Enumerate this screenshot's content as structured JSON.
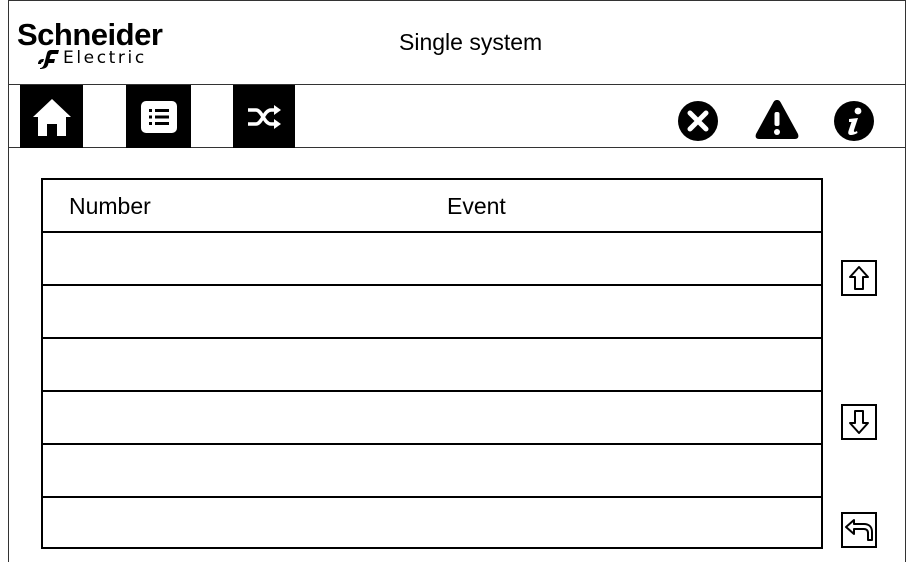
{
  "header": {
    "logo_brand": "Schneider",
    "logo_sub": "Electric",
    "title": "Single system"
  },
  "toolbar": {
    "buttons": [
      {
        "name": "home",
        "icon": "home-icon"
      },
      {
        "name": "menu",
        "icon": "list-icon"
      },
      {
        "name": "transfer",
        "icon": "shuffle-icon"
      }
    ],
    "status_icons": [
      {
        "name": "alarm",
        "icon": "close-circle-icon"
      },
      {
        "name": "warning",
        "icon": "warning-triangle-icon"
      },
      {
        "name": "info",
        "icon": "info-icon"
      }
    ]
  },
  "table": {
    "columns": [
      "Number",
      "Event"
    ],
    "rows": [
      {
        "number": "",
        "event": ""
      },
      {
        "number": "",
        "event": ""
      },
      {
        "number": "",
        "event": ""
      },
      {
        "number": "",
        "event": ""
      },
      {
        "number": "",
        "event": ""
      },
      {
        "number": "",
        "event": ""
      }
    ]
  },
  "side_controls": [
    {
      "name": "scroll-up",
      "icon": "arrow-up-icon"
    },
    {
      "name": "scroll-down",
      "icon": "arrow-down-icon"
    },
    {
      "name": "back",
      "icon": "return-arrow-icon"
    }
  ]
}
